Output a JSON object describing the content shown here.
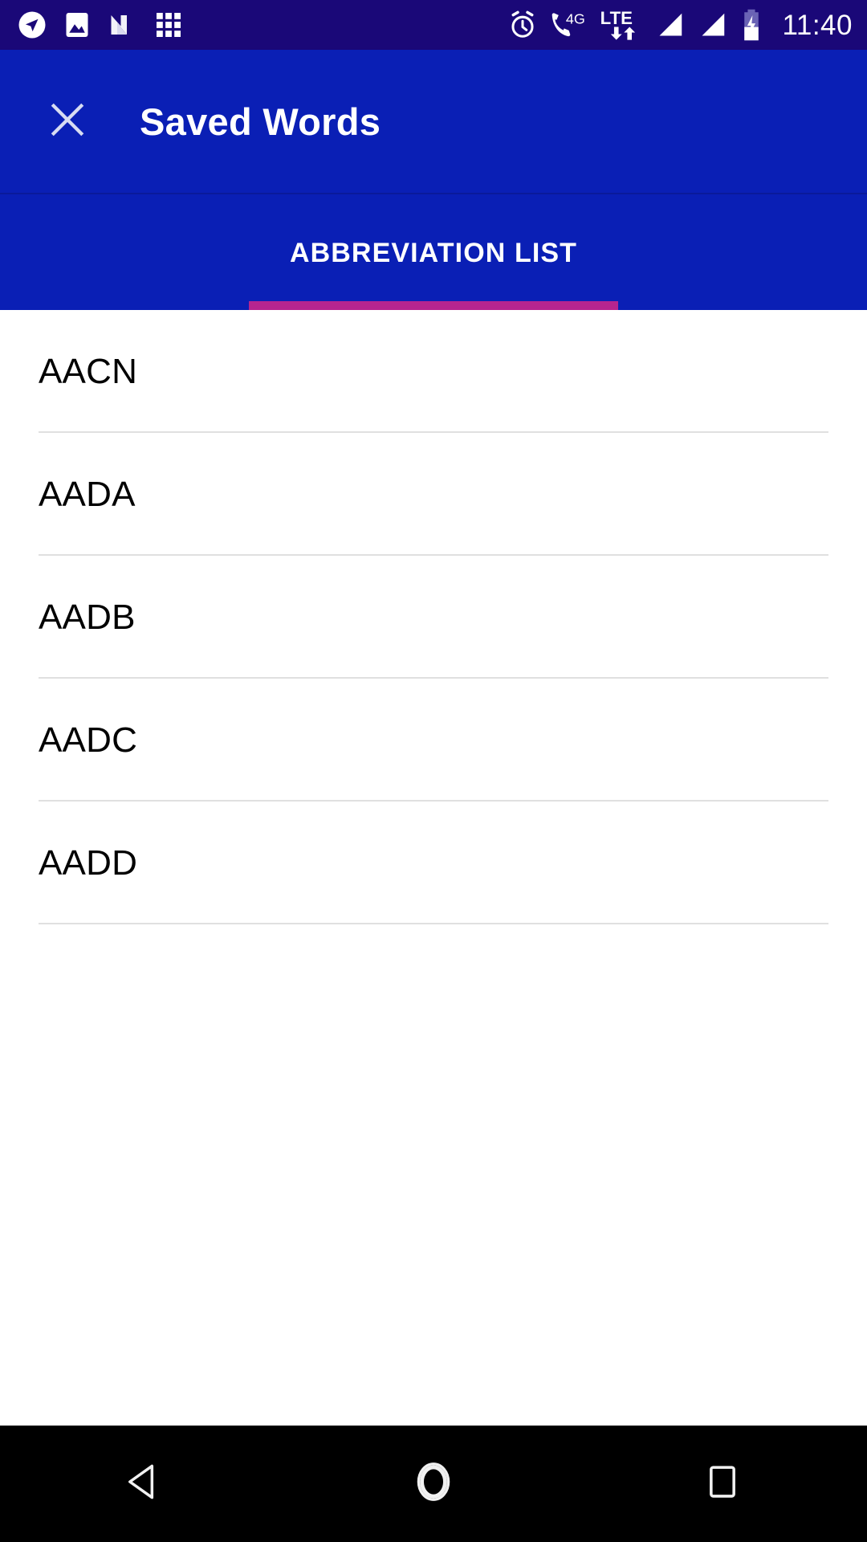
{
  "status_bar": {
    "background": "#1a0878",
    "time": "11:40",
    "left_icons": [
      {
        "name": "navigation-icon",
        "glyph": "navigation"
      },
      {
        "name": "photos-icon",
        "glyph": "image"
      },
      {
        "name": "android-n-icon",
        "glyph": "n-logo"
      },
      {
        "name": "apps-grid-icon",
        "glyph": "grid"
      }
    ],
    "right_icons": [
      {
        "name": "alarm-icon",
        "glyph": "alarm"
      },
      {
        "name": "call-4g-icon",
        "glyph": "phone-4g",
        "label": "4G"
      },
      {
        "name": "lte-icon",
        "glyph": "lte-arrows",
        "label": "LTE"
      },
      {
        "name": "signal-bars-1-icon",
        "glyph": "signal"
      },
      {
        "name": "signal-bars-2-icon",
        "glyph": "signal"
      },
      {
        "name": "battery-charging-icon",
        "glyph": "battery-bolt"
      }
    ]
  },
  "app_bar": {
    "background": "#0a1fb5",
    "close_icon": "close-icon",
    "title": "Saved Words"
  },
  "tabs": {
    "indicator_color": "#b5258f",
    "selected_index": 0,
    "items": [
      {
        "label": "ABBREVIATION LIST",
        "selected": true
      }
    ]
  },
  "list": {
    "items": [
      {
        "label": "AACN"
      },
      {
        "label": "AADA"
      },
      {
        "label": "AADB"
      },
      {
        "label": "AADC"
      },
      {
        "label": "AADD"
      }
    ]
  },
  "nav_bar": {
    "background": "#000000",
    "buttons": [
      {
        "name": "back-button",
        "icon": "back-triangle-icon"
      },
      {
        "name": "home-button",
        "icon": "home-circle-icon"
      },
      {
        "name": "recents-button",
        "icon": "recents-square-icon"
      }
    ]
  }
}
